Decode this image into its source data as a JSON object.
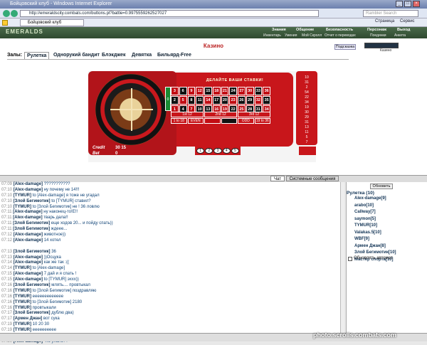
{
  "window": {
    "title": "Бойцовский клуб - Windows Internet Explorer"
  },
  "browser": {
    "address": "http://emeraldscity.combats.com/buttons.pl?battle=0.9975559262527027",
    "search_placeholder": "Rambler Search",
    "tab": "Бойцовский клуб",
    "page_menu": "Страница",
    "service_menu": "Сервис"
  },
  "game": {
    "logo": "EMERALDS",
    "nav_top": [
      "Знания",
      "Общение",
      "Безопасность",
      "Персонаж",
      "Выход"
    ],
    "nav_sub": [
      "Инвентарь",
      "Умения",
      "Мой Скролл",
      "Отчет о переводах",
      "Поединки",
      "Анкета"
    ],
    "page_title": "Казино",
    "hint_button": "Подсказка",
    "mini_label": "Казино",
    "halls_label": "Залы:",
    "halls": [
      "Рулетка",
      "Однорукий бандит",
      "Блэкджек",
      "Девятка",
      "Бильярд-Free"
    ],
    "banner": "ДЕЛАЙТЕ ВАШИ СТАВКИ!",
    "zero": "0",
    "grid": [
      [
        "3",
        "6",
        "9",
        "12",
        "15",
        "18",
        "21",
        "24",
        "27",
        "30",
        "33",
        "36"
      ],
      [
        "2",
        "5",
        "8",
        "11",
        "14",
        "17",
        "20",
        "23",
        "26",
        "29",
        "32",
        "35"
      ],
      [
        "1",
        "4",
        "7",
        "10",
        "13",
        "16",
        "19",
        "22",
        "25",
        "28",
        "31",
        "34"
      ]
    ],
    "dozens": [
      "1st 12",
      "2nd 12",
      "3rd 12"
    ],
    "evens": [
      "1 to 18",
      "EVEN",
      "",
      "",
      "ODD",
      "19 to 36"
    ],
    "credit_label": "Credit",
    "credit_value": "30 15",
    "bet_label": "Bet",
    "bet_value": "0",
    "history": [
      "10",
      "31",
      "2",
      "54",
      "22",
      "34",
      "19",
      "30",
      "29",
      "31",
      "13",
      "11",
      "5",
      "7"
    ],
    "chips": [
      "1",
      "2",
      "3",
      "4",
      "5"
    ]
  },
  "chat": {
    "tab_chat": "Чат",
    "tab_system": "Системные сообщения",
    "messages": [
      {
        "t": "07:09",
        "n": "[Alex-damage]",
        "m": " ???????????"
      },
      {
        "t": "07:10",
        "n": "[Alex-damage]",
        "m": " ну почему не 14!!!"
      },
      {
        "t": "07:10",
        "n": "[TYMUR]",
        "m": " to [Alex-damage] я тоже не угадал"
      },
      {
        "t": "07:10",
        "n": "[Злой Бегимотик]",
        "m": " to [TYMUR] ставил?"
      },
      {
        "t": "07:10",
        "n": "[TYMUR]",
        "m": " to [Злой Бегимотик] не ! 36 ловлю"
      },
      {
        "t": "07:11",
        "n": "[Alex-damage]",
        "m": " ну наконец-то!Е!!"
      },
      {
        "t": "07:11",
        "n": "[Alex-damage]",
        "m": " тварь дала!!"
      },
      {
        "t": "07:11",
        "n": "[Злой Бегимотик]",
        "m": " еще ходов 20... и пойду спать))"
      },
      {
        "t": "07:11",
        "n": "[Злой Бегимотик]",
        "m": " ждеее..."
      },
      {
        "t": "07:12",
        "n": "[Alex-damage]",
        "m": " животное))"
      },
      {
        "t": "07:12",
        "n": "[Alex-damage]",
        "m": " 14 хотел"
      },
      {
        "t": "",
        "n": "",
        "m": ""
      },
      {
        "t": "07:13",
        "n": "[Злой Бегимотик]",
        "m": " 36"
      },
      {
        "t": "07:13",
        "n": "[Alex-damage]",
        "m": " ))Осцука"
      },
      {
        "t": "07:14",
        "n": "[Alex-damage]",
        "m": " как же так :(("
      },
      {
        "t": "07:14",
        "n": "[TYMUR]",
        "m": " to [Alex-damage]"
      },
      {
        "t": "07:15",
        "n": "[Alex-damage]",
        "m": " 7 дай и я спать !"
      },
      {
        "t": "07:15",
        "n": "[Alex-damage]",
        "m": " to [TYMUR] эххх))"
      },
      {
        "t": "07:16",
        "n": "[Злой Бегимотик]",
        "m": " млять.... провтыкал"
      },
      {
        "t": "07:16",
        "n": "[TYMUR]",
        "m": " to [Злой Бегимотик] поздравляю"
      },
      {
        "t": "07:16",
        "n": "[TYMUR]",
        "m": " еееееееееееее"
      },
      {
        "t": "07:16",
        "n": "[TYMUR]",
        "m": " to [Злой Бегимотик] 2180"
      },
      {
        "t": "07:16",
        "n": "[TYMUR]",
        "m": " провтыкали"
      },
      {
        "t": "07:17",
        "n": "[Злой Бегимотик]",
        "m": " дублю два)"
      },
      {
        "t": "07:17",
        "n": "[Армен Джан]",
        "m": " вот сука"
      },
      {
        "t": "07:19",
        "n": "[TYMUR]",
        "m": " 10 20 30"
      },
      {
        "t": "07:19",
        "n": "[TYMUR]",
        "m": " ееееееееее"
      },
      {
        "t": "07:20",
        "n": "[Злой Бегимотик]",
        "m": " to [TYMUR] а сам-то на 30 не ставил]"
      },
      {
        "t": "07:20",
        "n": "[Alex-damage]",
        "m": " что упало??"
      }
    ]
  },
  "online": {
    "refresh": "Обновить",
    "title": "Рулетка (10)",
    "users": [
      "Alex-damage[9]",
      "arabo[10]",
      "Callway[7]",
      "saymon[5]",
      "TYMUR[10]",
      "Valakas.5[10]",
      "WBF[9]",
      "Армен Джан[8]",
      "Злой Бегимотик[10]",
      "Мастер спорта[10]"
    ],
    "auto_label": "Обновлять автомат."
  },
  "watermark": "photo.scrolls.combats.com"
}
